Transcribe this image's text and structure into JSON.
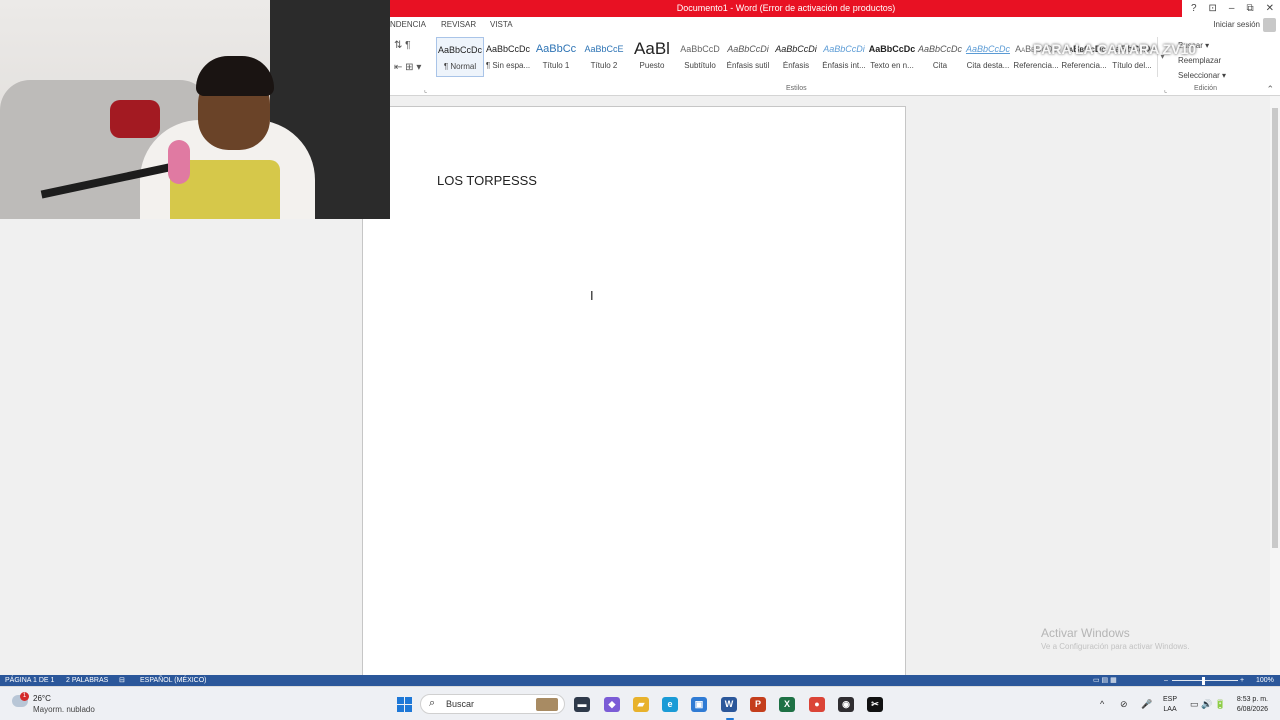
{
  "window": {
    "title": "Documento1 - Word (Error de activación de productos)",
    "help_glyph": "?",
    "ribbon_display_glyph": "⊡",
    "minimize_glyph": "–",
    "restore_glyph": "⧉",
    "close_glyph": "✕"
  },
  "tabs": [
    "NDENCIA",
    "REVISAR",
    "VISTA"
  ],
  "signin": "Iniciar sesión",
  "ribbon": {
    "para_icons_top": "⇅ ¶",
    "para_icons_bottom": "⇤ ⊞ ▾",
    "styles": [
      {
        "sample": "AaBbCcDc",
        "label": "¶ Normal"
      },
      {
        "sample": "AaBbCcDc",
        "label": "¶ Sin espa..."
      },
      {
        "sample": "AaBbCc",
        "label": "Título 1"
      },
      {
        "sample": "AaBbCcE",
        "label": "Título 2"
      },
      {
        "sample": "AaBl",
        "label": "Puesto"
      },
      {
        "sample": "AaBbCcD",
        "label": "Subtítulo"
      },
      {
        "sample": "AaBbCcDi",
        "label": "Énfasis sutil"
      },
      {
        "sample": "AaBbCcDi",
        "label": "Énfasis"
      },
      {
        "sample": "AaBbCcDi",
        "label": "Énfasis int..."
      },
      {
        "sample": "AaBbCcDc",
        "label": "Texto en n..."
      },
      {
        "sample": "AaBbCcDc",
        "label": "Cita"
      },
      {
        "sample": "AaBbCcDc",
        "label": "Cita desta..."
      },
      {
        "sample": "AaBbCcDc",
        "label": "Referencia..."
      },
      {
        "sample": "AaBbCcDc",
        "label": "Referencia..."
      },
      {
        "sample": "AaBbCcDc",
        "label": "Título del..."
      }
    ],
    "styles_more": "▾",
    "group_styles": "Estilos",
    "launcher_glyph": "⌞",
    "edit": {
      "find": "Buscar ▾",
      "replace": "Reemplazar",
      "select": "Seleccionar ▾"
    },
    "group_edit": "Edición",
    "collapse_glyph": "⌃"
  },
  "overlay_text": "PARA LA CAMARA ZV10",
  "document": {
    "text": "LOS TORPESSS",
    "cursor_glyph": "I"
  },
  "watermark": {
    "title": "Activar Windows",
    "subtitle": "Ve a Configuración para activar Windows."
  },
  "statusbar": {
    "page": "PÁGINA 1 DE 1",
    "words": "2 PALABRAS",
    "proofing_glyph": "⊟",
    "language": "ESPAÑOL (MÉXICO)",
    "view_glyphs": "▭  ▤  ▦",
    "zoom_minus": "–",
    "zoom_plus": "+",
    "zoom": "100%",
    "zoom_level_percent": 100
  },
  "taskbar": {
    "weather_badge": "1",
    "weather_temp": "26°C",
    "weather_desc": "Mayorm. nublado",
    "search_glyph": "⌕",
    "search_label": "Buscar",
    "apps": [
      {
        "name": "file-explorer-dark",
        "glyph": "▬",
        "color": "#2f3a4a"
      },
      {
        "name": "copilot",
        "glyph": "◆",
        "color": "#7b5cd6"
      },
      {
        "name": "folder",
        "glyph": "▰",
        "color": "#e8b22c"
      },
      {
        "name": "edge",
        "glyph": "e",
        "color": "#1a9bd6"
      },
      {
        "name": "store",
        "glyph": "▣",
        "color": "#2f7bd4"
      },
      {
        "name": "word",
        "glyph": "W",
        "color": "#2b579a"
      },
      {
        "name": "powerpoint",
        "glyph": "P",
        "color": "#c43e1c"
      },
      {
        "name": "excel",
        "glyph": "X",
        "color": "#1e7145"
      },
      {
        "name": "chrome",
        "glyph": "●",
        "color": "#db4437"
      },
      {
        "name": "obs",
        "glyph": "◉",
        "color": "#302e31"
      },
      {
        "name": "capcut",
        "glyph": "✂",
        "color": "#111111"
      }
    ],
    "tray_glyphs": [
      "^",
      "⊘",
      "🎤"
    ],
    "lang_top": "ESP",
    "lang_bottom": "LAA",
    "sys_glyphs": "▭ 🔊 🔋",
    "time": "8:53 p. m.",
    "date": "6/08/2026"
  }
}
